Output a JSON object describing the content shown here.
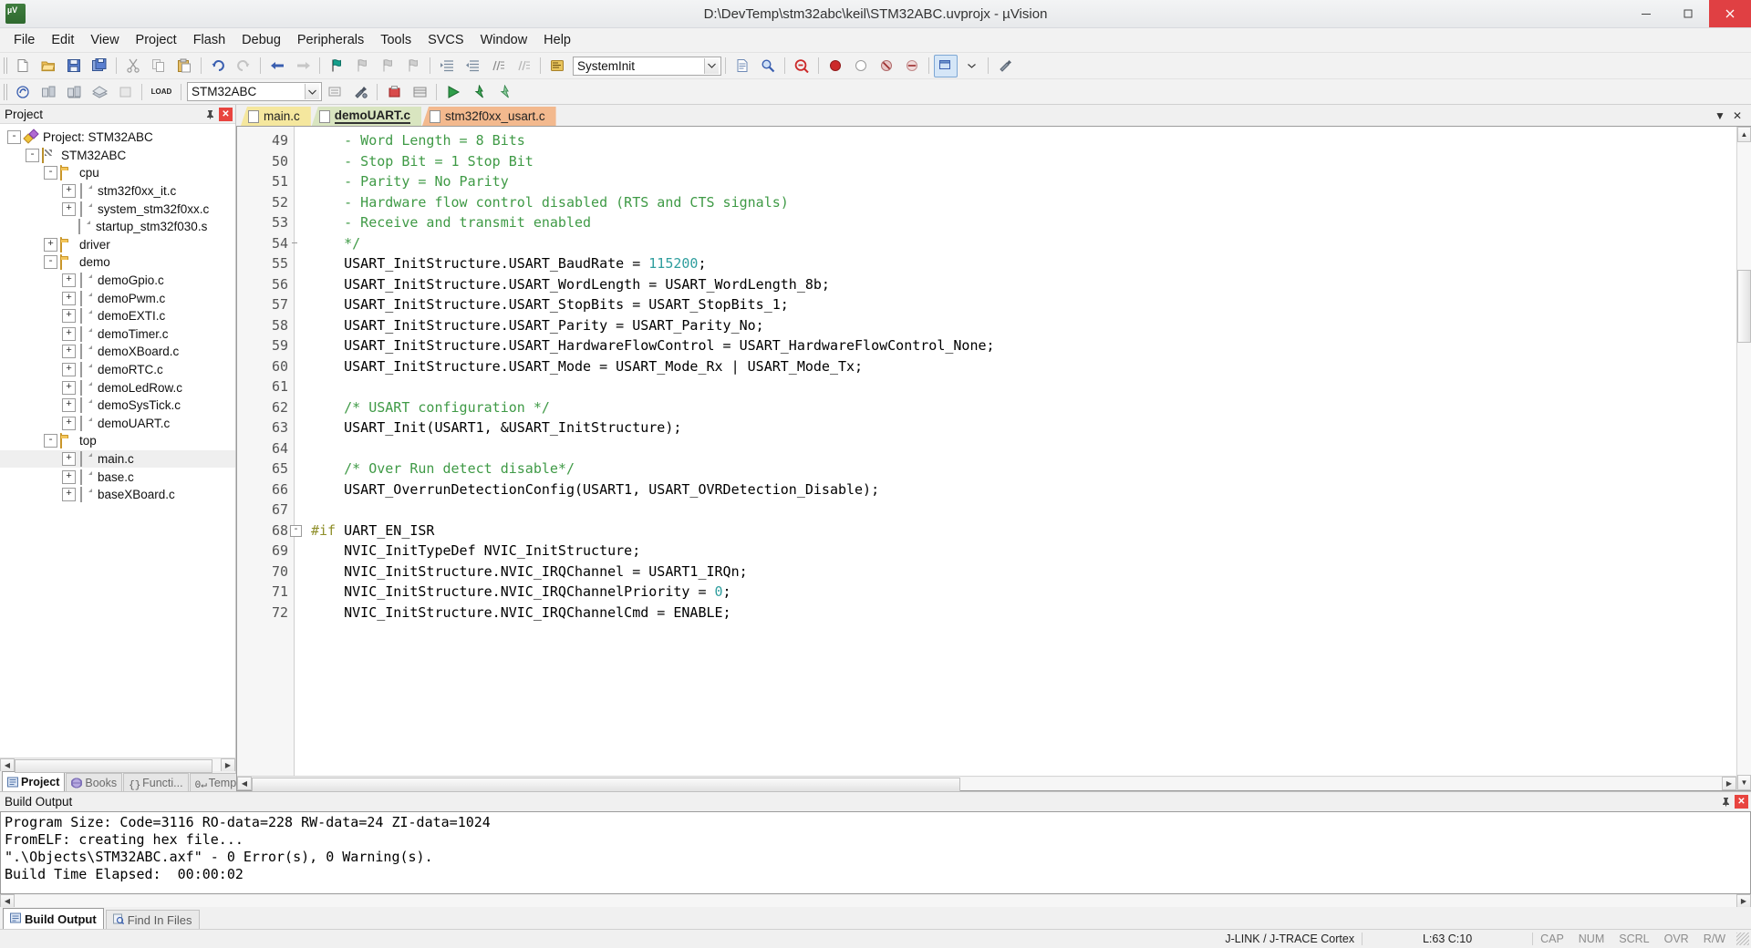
{
  "window": {
    "title": "D:\\DevTemp\\stm32abc\\keil\\STM32ABC.uvprojx - µVision",
    "minimize_label": "–",
    "maximize_label": "❐",
    "close_label": "✕"
  },
  "menubar": {
    "items": [
      "File",
      "Edit",
      "View",
      "Project",
      "Flash",
      "Debug",
      "Peripherals",
      "Tools",
      "SVCS",
      "Window",
      "Help"
    ]
  },
  "toolbar_main": {
    "function_combo_value": "SystemInit",
    "combo_arrow": "▼"
  },
  "toolbar_build": {
    "target_combo_value": "STM32ABC",
    "load_label": "LOAD",
    "combo_arrow": "▼"
  },
  "project_panel": {
    "caption": "Project",
    "pin_label": "⚑",
    "close_label": "✕",
    "tree": [
      {
        "label": "Project: STM32ABC",
        "depth": 0,
        "expander": "-",
        "icon": "project-icon",
        "selected": false
      },
      {
        "label": "STM32ABC",
        "depth": 1,
        "expander": "-",
        "icon": "target-icon",
        "selected": false
      },
      {
        "label": "cpu",
        "depth": 2,
        "expander": "-",
        "icon": "folder-icon",
        "selected": false
      },
      {
        "label": "stm32f0xx_it.c",
        "depth": 3,
        "expander": "+",
        "icon": "file-icon",
        "selected": false
      },
      {
        "label": "system_stm32f0xx.c",
        "depth": 3,
        "expander": "+",
        "icon": "file-icon",
        "selected": false
      },
      {
        "label": "startup_stm32f030.s",
        "depth": 3,
        "expander": "",
        "icon": "file-icon",
        "selected": false
      },
      {
        "label": "driver",
        "depth": 2,
        "expander": "+",
        "icon": "folder-icon",
        "selected": false
      },
      {
        "label": "demo",
        "depth": 2,
        "expander": "-",
        "icon": "folder-icon",
        "selected": false
      },
      {
        "label": "demoGpio.c",
        "depth": 3,
        "expander": "+",
        "icon": "file-icon",
        "selected": false
      },
      {
        "label": "demoPwm.c",
        "depth": 3,
        "expander": "+",
        "icon": "file-icon",
        "selected": false
      },
      {
        "label": "demoEXTI.c",
        "depth": 3,
        "expander": "+",
        "icon": "file-icon",
        "selected": false
      },
      {
        "label": "demoTimer.c",
        "depth": 3,
        "expander": "+",
        "icon": "file-icon",
        "selected": false
      },
      {
        "label": "demoXBoard.c",
        "depth": 3,
        "expander": "+",
        "icon": "file-icon",
        "selected": false
      },
      {
        "label": "demoRTC.c",
        "depth": 3,
        "expander": "+",
        "icon": "file-icon",
        "selected": false
      },
      {
        "label": "demoLedRow.c",
        "depth": 3,
        "expander": "+",
        "icon": "file-icon",
        "selected": false
      },
      {
        "label": "demoSysTick.c",
        "depth": 3,
        "expander": "+",
        "icon": "file-icon",
        "selected": false
      },
      {
        "label": "demoUART.c",
        "depth": 3,
        "expander": "+",
        "icon": "file-icon",
        "selected": false
      },
      {
        "label": "top",
        "depth": 2,
        "expander": "-",
        "icon": "folder-icon",
        "selected": false
      },
      {
        "label": "main.c",
        "depth": 3,
        "expander": "+",
        "icon": "file-icon",
        "selected": true
      },
      {
        "label": "base.c",
        "depth": 3,
        "expander": "+",
        "icon": "file-icon",
        "selected": false
      },
      {
        "label": "baseXBoard.c",
        "depth": 3,
        "expander": "+",
        "icon": "file-icon",
        "selected": false
      }
    ],
    "tabs": [
      {
        "label": "Project",
        "icon": "project-tab-icon",
        "active": true
      },
      {
        "label": "Books",
        "icon": "books-tab-icon",
        "active": false
      },
      {
        "label": "Functi...",
        "icon": "functions-tab-icon",
        "active": false
      },
      {
        "label": "Templ...",
        "icon": "templates-tab-icon",
        "active": false
      }
    ],
    "scroll_left": "◀",
    "scroll_right": "▶"
  },
  "editor": {
    "tabs": [
      {
        "label": "main.c",
        "style": "t-main",
        "active": false
      },
      {
        "label": "demoUART.c",
        "style": "t-active",
        "active": true
      },
      {
        "label": "stm32f0xx_usart.c",
        "style": "t-usart",
        "active": false
      }
    ],
    "window_restore": "▼",
    "window_close": "✕",
    "first_line_number": 49,
    "lines": [
      {
        "n": 49,
        "fold": "",
        "segments": [
          {
            "t": "    - Word Length = 8 Bits",
            "c": "cmt"
          }
        ]
      },
      {
        "n": 50,
        "fold": "",
        "segments": [
          {
            "t": "    - Stop Bit = 1 Stop Bit",
            "c": "cmt"
          }
        ]
      },
      {
        "n": 51,
        "fold": "",
        "segments": [
          {
            "t": "    - Parity = No Parity",
            "c": "cmt"
          }
        ]
      },
      {
        "n": 52,
        "fold": "",
        "segments": [
          {
            "t": "    - Hardware flow control disabled (RTS and CTS signals)",
            "c": "cmt"
          }
        ]
      },
      {
        "n": 53,
        "fold": "",
        "segments": [
          {
            "t": "    - Receive and transmit enabled",
            "c": "cmt"
          }
        ]
      },
      {
        "n": 54,
        "fold": "|",
        "segments": [
          {
            "t": "    */",
            "c": "cmt"
          }
        ]
      },
      {
        "n": 55,
        "fold": "",
        "segments": [
          {
            "t": "    USART_InitStructure.USART_BaudRate = ",
            "c": ""
          },
          {
            "t": "115200",
            "c": "num"
          },
          {
            "t": ";",
            "c": ""
          }
        ]
      },
      {
        "n": 56,
        "fold": "",
        "segments": [
          {
            "t": "    USART_InitStructure.USART_WordLength = USART_WordLength_8b;",
            "c": ""
          }
        ]
      },
      {
        "n": 57,
        "fold": "",
        "segments": [
          {
            "t": "    USART_InitStructure.USART_StopBits = USART_StopBits_1;",
            "c": ""
          }
        ]
      },
      {
        "n": 58,
        "fold": "",
        "segments": [
          {
            "t": "    USART_InitStructure.USART_Parity = USART_Parity_No;",
            "c": ""
          }
        ]
      },
      {
        "n": 59,
        "fold": "",
        "segments": [
          {
            "t": "    USART_InitStructure.USART_HardwareFlowControl = USART_HardwareFlowControl_None;",
            "c": ""
          }
        ]
      },
      {
        "n": 60,
        "fold": "",
        "segments": [
          {
            "t": "    USART_InitStructure.USART_Mode = USART_Mode_Rx | USART_Mode_Tx;",
            "c": ""
          }
        ]
      },
      {
        "n": 61,
        "fold": "",
        "segments": [
          {
            "t": "",
            "c": ""
          }
        ]
      },
      {
        "n": 62,
        "fold": "",
        "segments": [
          {
            "t": "    /* USART configuration */",
            "c": "cmt"
          }
        ]
      },
      {
        "n": 63,
        "fold": "",
        "segments": [
          {
            "t": "    USART_Init(USART1, &USART_InitStructure);",
            "c": ""
          }
        ]
      },
      {
        "n": 64,
        "fold": "",
        "segments": [
          {
            "t": "",
            "c": ""
          }
        ]
      },
      {
        "n": 65,
        "fold": "",
        "segments": [
          {
            "t": "    /* Over Run detect disable*/",
            "c": "cmt"
          }
        ]
      },
      {
        "n": 66,
        "fold": "",
        "segments": [
          {
            "t": "    USART_OverrunDetectionConfig(USART1, USART_OVRDetection_Disable);",
            "c": ""
          }
        ]
      },
      {
        "n": 67,
        "fold": "",
        "segments": [
          {
            "t": "",
            "c": ""
          }
        ]
      },
      {
        "n": 68,
        "fold": "-",
        "segments": [
          {
            "t": "#if",
            "c": "pp"
          },
          {
            "t": " UART_EN_ISR",
            "c": ""
          }
        ]
      },
      {
        "n": 69,
        "fold": "",
        "segments": [
          {
            "t": "    NVIC_InitTypeDef NVIC_InitStructure;",
            "c": ""
          }
        ]
      },
      {
        "n": 70,
        "fold": "",
        "segments": [
          {
            "t": "    NVIC_InitStructure.NVIC_IRQChannel = USART1_IRQn;",
            "c": ""
          }
        ]
      },
      {
        "n": 71,
        "fold": "",
        "segments": [
          {
            "t": "    NVIC_InitStructure.NVIC_IRQChannelPriority = ",
            "c": ""
          },
          {
            "t": "0",
            "c": "num"
          },
          {
            "t": ";",
            "c": ""
          }
        ]
      },
      {
        "n": 72,
        "fold": "",
        "segments": [
          {
            "t": "    NVIC_InitStructure.NVIC_IRQChannelCmd = ENABLE;",
            "c": ""
          }
        ]
      }
    ],
    "scroll_up": "▲",
    "scroll_down": "▼",
    "scroll_left": "◀",
    "scroll_right": "▶"
  },
  "build_output": {
    "caption": "Build Output",
    "pin_label": "⚑",
    "close_label": "✕",
    "lines": [
      "Program Size: Code=3116 RO-data=228 RW-data=24 ZI-data=1024",
      "FromELF: creating hex file...",
      "\".\\Objects\\STM32ABC.axf\" - 0 Error(s), 0 Warning(s).",
      "Build Time Elapsed:  00:00:02"
    ],
    "tabs": [
      {
        "label": "Build Output",
        "icon": "build-output-icon",
        "active": true
      },
      {
        "label": "Find In Files",
        "icon": "find-in-files-icon",
        "active": false
      }
    ],
    "scroll_left": "◀",
    "scroll_right": "▶"
  },
  "statusbar": {
    "debugger": "J-LINK / J-TRACE Cortex",
    "cursor_position": "L:63 C:10",
    "indicators": [
      "CAP",
      "NUM",
      "SCRL",
      "OVR",
      "R/W"
    ]
  },
  "colors": {
    "comment_green": "#3f9a46",
    "number_teal": "#2f9e9e",
    "preprocessor": "#8f8f2a",
    "tab_main": "#f5e79e",
    "tab_active": "#d9e5c0",
    "tab_usart": "#f3b98e",
    "close_red": "#e04043"
  }
}
